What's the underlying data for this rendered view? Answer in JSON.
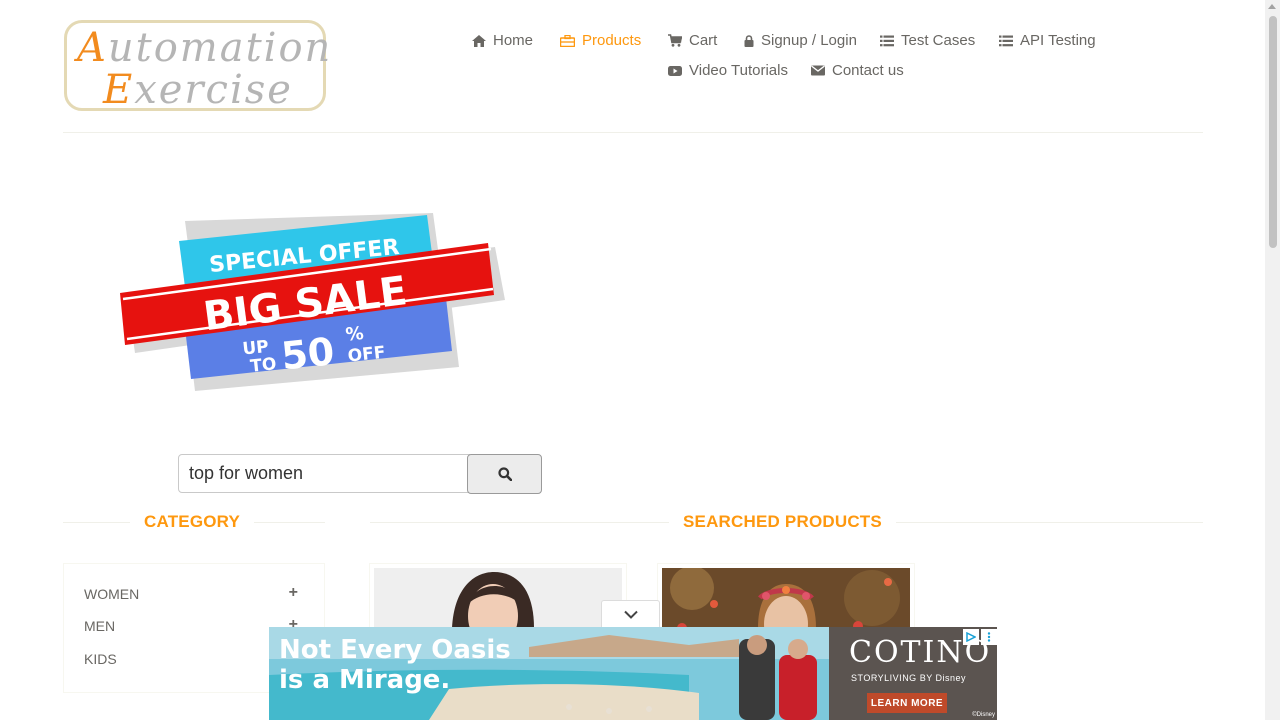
{
  "logo": {
    "line1": "utomation",
    "line1_cap": "A",
    "line2": "xercise",
    "line2_cap": "E"
  },
  "nav": {
    "items": [
      {
        "label": "Home",
        "icon": "home-icon",
        "active": false
      },
      {
        "label": "Products",
        "icon": "products-icon",
        "active": true
      },
      {
        "label": "Cart",
        "icon": "cart-icon",
        "active": false
      },
      {
        "label": "Signup / Login",
        "icon": "lock-icon",
        "active": false
      },
      {
        "label": "Test Cases",
        "icon": "list-icon",
        "active": false
      },
      {
        "label": "API Testing",
        "icon": "list-icon",
        "active": false
      },
      {
        "label": "Video Tutorials",
        "icon": "youtube-icon",
        "active": false
      },
      {
        "label": "Contact us",
        "icon": "envelope-icon",
        "active": false
      }
    ]
  },
  "banner": {
    "line1": "SPECIAL OFFER",
    "line2": "BIG SALE",
    "up": "UP",
    "to": "TO",
    "amount": "50",
    "percent": "%",
    "off": "OFF"
  },
  "search": {
    "value": "top for women",
    "button_icon": "search-icon"
  },
  "sidebar": {
    "title": "CATEGORY",
    "items": [
      {
        "label": "WOMEN",
        "toggle": "+"
      },
      {
        "label": "MEN",
        "toggle": "+"
      },
      {
        "label": "KIDS",
        "toggle": "+"
      }
    ]
  },
  "main": {
    "title": "SEARCHED PRODUCTS"
  },
  "ad": {
    "headline_line1": "Not Every Oasis",
    "headline_line2": "is a Mirage.",
    "brand": "COTINO",
    "subline": "STORYLIVING BY Disney",
    "cta": "LEARN MORE",
    "copyright": "©Disney"
  },
  "colors": {
    "accent": "#fe980f",
    "text": "#696763",
    "banner_blue": "#2fc6ea",
    "banner_red": "#e6120f",
    "banner_purple": "#5b7fe6",
    "ad_cta": "#bf4a2a"
  }
}
